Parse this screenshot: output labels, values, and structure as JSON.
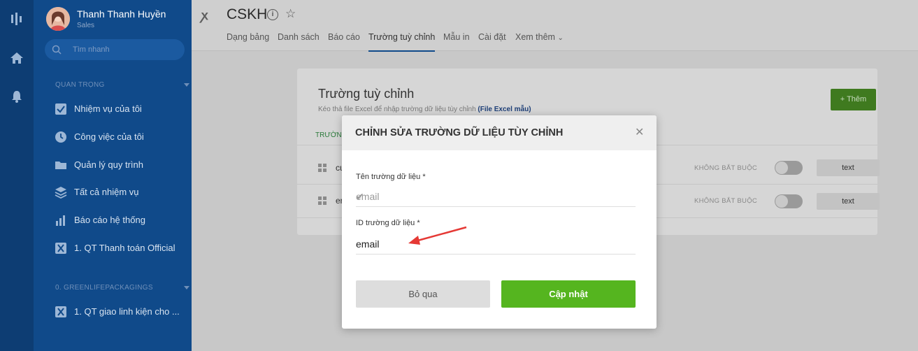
{
  "user": {
    "name": "Thanh Thanh Huyền",
    "role": "Sales"
  },
  "sidebar": {
    "search_placeholder": "Tìm nhanh",
    "section_important": "QUAN TRỌNG",
    "items": [
      {
        "label": "Nhiệm vụ của tôi",
        "icon": "checkbox-icon"
      },
      {
        "label": "Công việc của tôi",
        "icon": "clock-icon"
      },
      {
        "label": "Quản lý quy trình",
        "icon": "folder-icon"
      },
      {
        "label": "Tất cả nhiệm vụ",
        "icon": "layers-icon"
      },
      {
        "label": "Báo cáo hệ thống",
        "icon": "bar-chart-icon"
      },
      {
        "label": "1. QT Thanh toán Official",
        "icon": "workflow-logo-icon"
      }
    ],
    "section_company": "0. GREENLIFEPACKAGINGS",
    "company_items": [
      {
        "label": "1. QT giao linh kiện cho ...",
        "icon": "workflow-logo-icon"
      }
    ]
  },
  "header": {
    "title": "CSKH",
    "tabs": [
      "Dạng bảng",
      "Danh sách",
      "Báo cáo",
      "Trường tuỳ chỉnh",
      "Mẫu in",
      "Cài đặt",
      "Xem thêm"
    ],
    "active_tab": "Trường tuỳ chỉnh"
  },
  "card": {
    "title": "Trường tuỳ chỉnh",
    "subtitle": "Kéo thả file Excel để nhập trường dữ liệu tùy chỉnh",
    "subtitle_link": "(File Excel mẫu)",
    "add_label": "+ Thêm",
    "head_label": "TRƯỜNG",
    "rows": [
      {
        "name": "cu",
        "required": "KHÔNG BẮT BUỘC",
        "type": "text"
      },
      {
        "name": "er",
        "required": "KHÔNG BẮT BUỘC",
        "type": "text"
      }
    ]
  },
  "modal": {
    "title": "CHỈNH SỬA TRƯỜNG DỮ LIỆU TÙY CHỈNH",
    "field_name_label": "Tên trường dữ liệu *",
    "field_name_value": "email",
    "field_id_label": "ID trường dữ liệu *",
    "field_id_value": "email",
    "cancel_label": "Bỏ qua",
    "update_label": "Cập nhật"
  },
  "colors": {
    "sidebar": "#104a8a",
    "rail": "#0d3d73",
    "update_button": "#55b51f",
    "annotation_arrow": "#e53935"
  }
}
